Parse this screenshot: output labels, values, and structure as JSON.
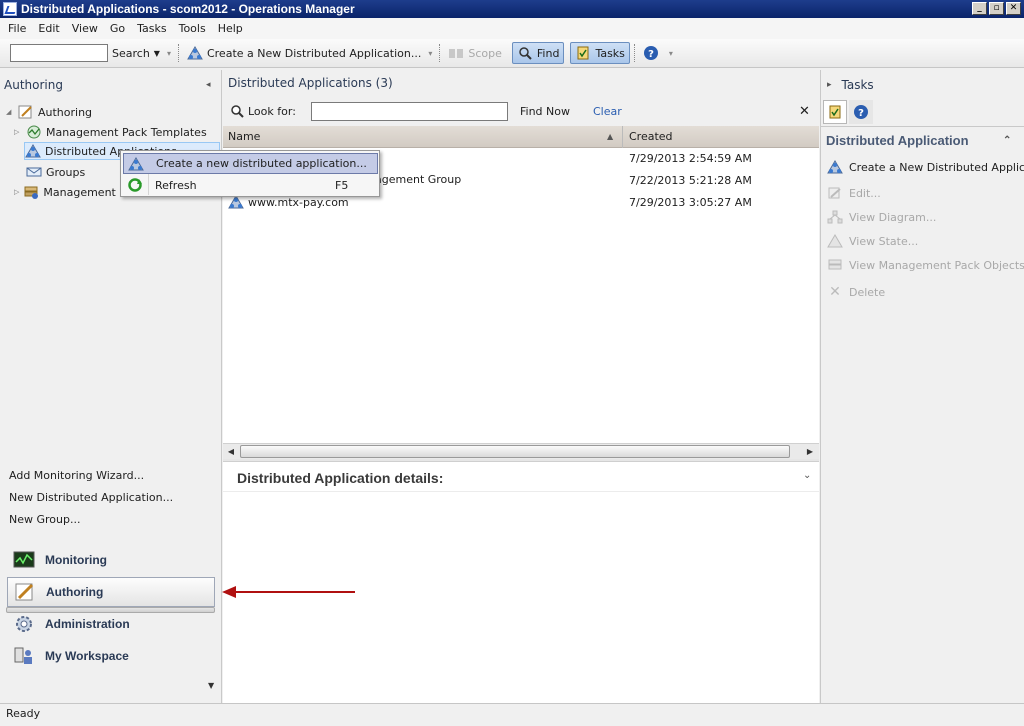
{
  "window": {
    "title": "Distributed Applications - scom2012 - Operations Manager"
  },
  "menu": [
    "File",
    "Edit",
    "View",
    "Go",
    "Tasks",
    "Tools",
    "Help"
  ],
  "toolbar": {
    "search_label": "Search",
    "create_label": "Create a New Distributed Application...",
    "scope_label": "Scope",
    "find_label": "Find",
    "tasks_label": "Tasks"
  },
  "left": {
    "header": "Authoring",
    "tree": {
      "root": "Authoring",
      "items": [
        "Management Pack Templates",
        "Distributed Applications",
        "Groups",
        "Management Pack Objects"
      ]
    },
    "links": [
      "Add Monitoring Wizard...",
      "New Distributed Application...",
      "New Group..."
    ],
    "wunderbar": [
      "Monitoring",
      "Authoring",
      "Administration",
      "My Workspace"
    ]
  },
  "context_menu": {
    "items": [
      {
        "label": "Create a new distributed application...",
        "shortcut": ""
      },
      {
        "label": "Refresh",
        "shortcut": "F5"
      }
    ]
  },
  "center": {
    "header": "Distributed Applications (3)",
    "look_for": "Look for:",
    "find_now": "Find Now",
    "clear": "Clear",
    "columns": [
      "Name",
      "Created"
    ],
    "rows": [
      {
        "name": "",
        "created": "7/29/2013 2:54:59 AM"
      },
      {
        "name": "agement Group",
        "created": "7/22/2013 5:21:28 AM"
      },
      {
        "name": "www.mtx-pay.com",
        "created": "7/29/2013 3:05:27 AM"
      }
    ],
    "details_title": "Distributed Application details:"
  },
  "right": {
    "header": "Tasks",
    "section": "Distributed Application",
    "tasks": [
      {
        "label": "Create a New Distributed Application",
        "enabled": true
      },
      {
        "label": "Edit...",
        "enabled": false
      },
      {
        "label": "View Diagram...",
        "enabled": false
      },
      {
        "label": "View State...",
        "enabled": false
      },
      {
        "label": "View Management Pack Objects...",
        "enabled": false
      },
      {
        "label": "Delete",
        "enabled": false
      }
    ]
  },
  "status": {
    "text": "Ready"
  },
  "colors": {
    "title_bar": "#0a246a",
    "selection": "#dcebfc",
    "annotation_arrow": "#b01010",
    "accent_link": "#2a5db0"
  }
}
